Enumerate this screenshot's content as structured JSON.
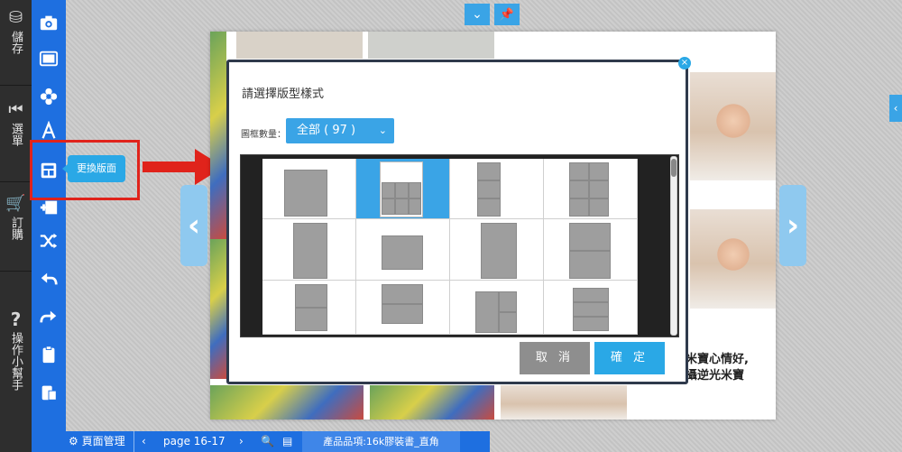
{
  "rail": {
    "save": "儲存",
    "menu": "選單",
    "order": "訂購",
    "help": "操作小幫手"
  },
  "tools": {
    "tooltip": "更換版面"
  },
  "book": {
    "caption_line1": "米寶心情好,",
    "caption_line2": "攝逆光米寶"
  },
  "modal": {
    "title": "請選擇版型樣式",
    "frame_label": "圖框數量：",
    "select_value": "全部 ( 97 )",
    "cancel": "取 消",
    "confirm": "確 定"
  },
  "bottombar": {
    "page_manage": "頁面管理",
    "page": "page 16-17",
    "product": "產品品項:16k膠裝書_直角"
  },
  "colors": {
    "accent": "#2aa8e6",
    "toolbar": "#1e6fe0",
    "highlight": "#e0231b"
  }
}
